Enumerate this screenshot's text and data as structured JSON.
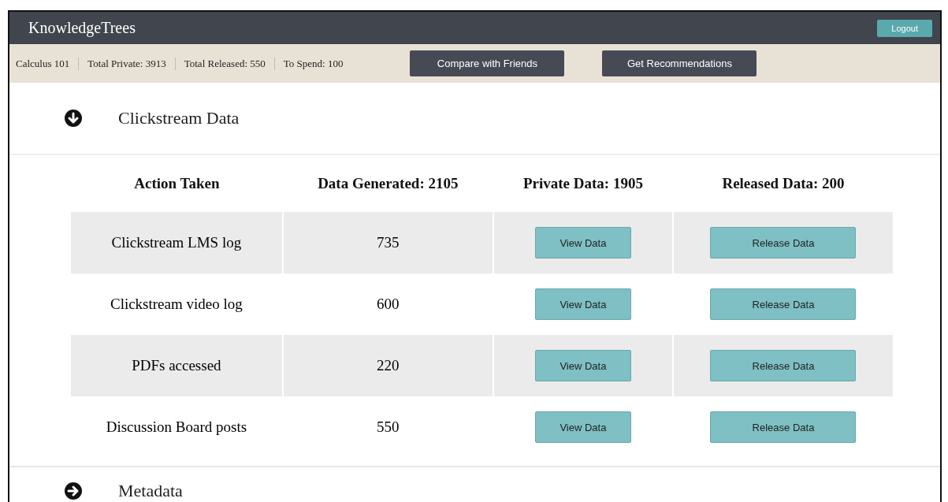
{
  "app_title": "KnowledgeTrees",
  "logout": "Logout",
  "stats": [
    "Calculus 101",
    "Total Private: 3913",
    "Total Released: 550",
    "To Spend: 100"
  ],
  "actions": [
    "Compare with Friends",
    "Get Recommendations"
  ],
  "sections": [
    {
      "title": "Clickstream Data",
      "expanded": true,
      "table": {
        "columns": [
          "Action Taken",
          "Data Generated: 2105",
          "Private Data: 1905",
          "Released Data: 200"
        ],
        "rows": [
          {
            "action": "Clickstream LMS log",
            "generated": "735",
            "view": "View Data",
            "release": "Release Data"
          },
          {
            "action": "Clickstream video log",
            "generated": "600",
            "view": "View Data",
            "release": "Release Data"
          },
          {
            "action": "PDFs accessed",
            "generated": "220",
            "view": "View Data",
            "release": "Release Data"
          },
          {
            "action": "Discussion Board posts",
            "generated": "550",
            "view": "View Data",
            "release": "Release Data"
          }
        ]
      }
    },
    {
      "title": "Metadata",
      "expanded": false
    }
  ]
}
